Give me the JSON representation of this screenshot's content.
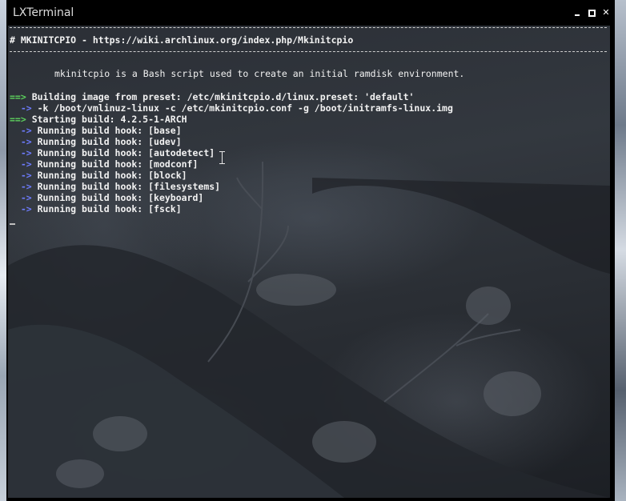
{
  "window": {
    "title": "LXTerminal",
    "controls": {
      "minimize": "minimize-icon",
      "maximize": "maximize-icon",
      "close": "close-icon"
    }
  },
  "terminal": {
    "header": {
      "line": "# MKINITCPIO - https://wiki.archlinux.org/index.php/Mkinitcpio"
    },
    "description": "mkinitcpio is a Bash script used to create an initial ramdisk environment.",
    "lines": [
      {
        "marker": "==>",
        "marker_color": "#5dd35d",
        "text": "Building image from preset: /etc/mkinitcpio.d/linux.preset: 'default'"
      },
      {
        "marker": "->",
        "marker_color": "#6e7cff",
        "text": "-k /boot/vmlinuz-linux -c /etc/mkinitcpio.conf -g /boot/initramfs-linux.img"
      },
      {
        "marker": "==>",
        "marker_color": "#5dd35d",
        "text": "Starting build: 4.2.5-1-ARCH"
      },
      {
        "marker": "->",
        "marker_color": "#6e7cff",
        "text": "Running build hook: [base]"
      },
      {
        "marker": "->",
        "marker_color": "#6e7cff",
        "text": "Running build hook: [udev]"
      },
      {
        "marker": "->",
        "marker_color": "#6e7cff",
        "text": "Running build hook: [autodetect]"
      },
      {
        "marker": "->",
        "marker_color": "#6e7cff",
        "text": "Running build hook: [modconf]"
      },
      {
        "marker": "->",
        "marker_color": "#6e7cff",
        "text": "Running build hook: [block]"
      },
      {
        "marker": "->",
        "marker_color": "#6e7cff",
        "text": "Running build hook: [filesystems]"
      },
      {
        "marker": "->",
        "marker_color": "#6e7cff",
        "text": "Running build hook: [keyboard]"
      },
      {
        "marker": "->",
        "marker_color": "#6e7cff",
        "text": "Running build hook: [fsck]"
      }
    ]
  }
}
